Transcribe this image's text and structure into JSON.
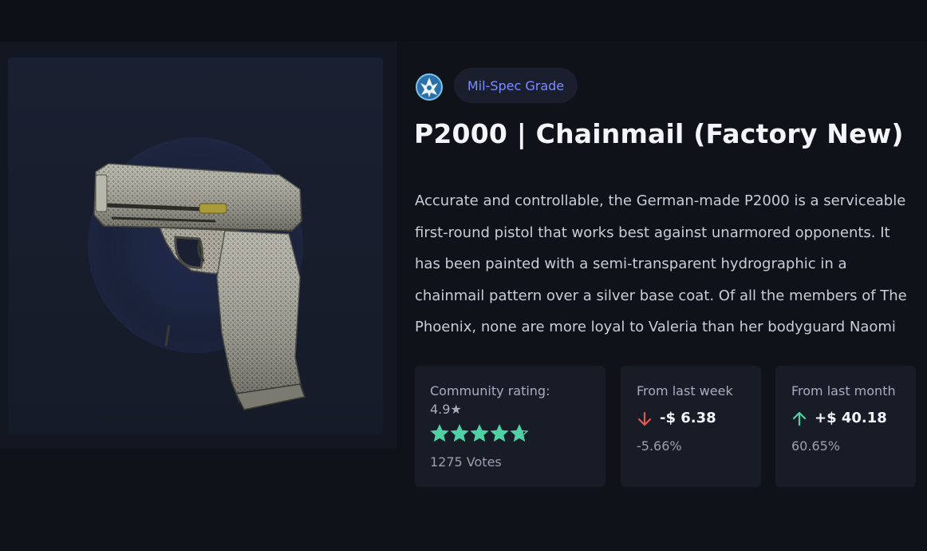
{
  "item": {
    "grade_icon": "phoenix-icon",
    "grade_label": "Mil-Spec Grade",
    "title": "P2000 | Chainmail (Factory New)",
    "description": "Accurate and controllable, the German-made P2000 is a serviceable first-round pistol that works best against unarmored opponents. It has been painted with a semi-transparent hydrographic in a chainmail pattern over a silver base coat. Of all the members of The Phoenix, none are more loyal to Valeria than her bodyguard Naomi"
  },
  "rating": {
    "label": "Community rating:",
    "value": "4.9★",
    "stars_filled": 4.7,
    "stars_total": 5,
    "votes": "1275 Votes"
  },
  "week": {
    "label": "From last week",
    "change": "-$ 6.38",
    "percent": "-5.66%",
    "trend_icon": "arrow-down-icon"
  },
  "month": {
    "label": "From last month",
    "change": "+$ 40.18",
    "percent": "60.65%",
    "trend_icon": "arrow-up-icon"
  },
  "colors": {
    "background": "#101219",
    "card": "#181c27",
    "grade_text": "#7b8cff",
    "star": "#4fd1a5",
    "down": "#e0584f",
    "up": "#4fd1a5"
  }
}
